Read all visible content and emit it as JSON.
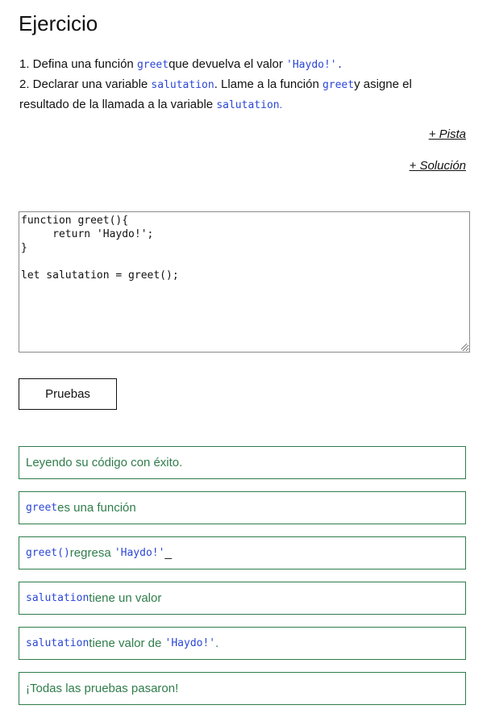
{
  "title": "Ejercicio",
  "instructions": {
    "line1": {
      "pre": "1. Defina una función ",
      "code1": "greet",
      "mid": "que devuelva el valor ",
      "code2": "'Haydo!'",
      "post": "."
    },
    "line2": {
      "pre": "2. Declarar una variable ",
      "code1": "salutation",
      "mid": ". Llame a la función ",
      "code2": "greet",
      "post": "y asigne el"
    },
    "line3": {
      "pre": "resultado de la llamada a la variable ",
      "code1": "salutation",
      "post": "."
    }
  },
  "links": {
    "hint": "+ Pista",
    "solution": "+ Solución"
  },
  "editor": {
    "code": "function greet(){\n     return 'Haydo!';\n}\n\nlet salutation = greet();"
  },
  "buttons": {
    "run_tests": "Pruebas"
  },
  "results": [
    {
      "text": "Leyendo su código con éxito."
    },
    {
      "code": "greet",
      "text": "es una función"
    },
    {
      "code": "greet()",
      "text": "regresa ",
      "code2": "'Haydo!'",
      "post": "_"
    },
    {
      "code": "salutation",
      "text": "tiene un valor"
    },
    {
      "code": "salutation",
      "text": "tiene valor de ",
      "code2": "'Haydo!'",
      "post": "."
    },
    {
      "text": "¡Todas las pruebas pasaron!"
    }
  ],
  "colors": {
    "code": "#2b46d6",
    "success": "#2f7d4a",
    "text": "#111111"
  }
}
